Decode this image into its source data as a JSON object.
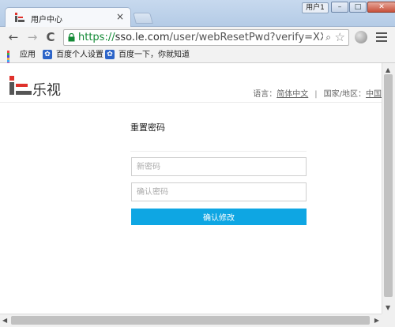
{
  "browser": {
    "tab_title": "用户中心",
    "tab_close": "×",
    "user_label": "用户1",
    "window_buttons": {
      "minimize": "–",
      "maximize": "□",
      "close": "✕"
    },
    "nav": {
      "back": "←",
      "forward": "→",
      "reload": "C"
    },
    "url_scheme": "https://",
    "url_host": "sso.le.com",
    "url_path": "/user/webResetPwd?verify=XXXhaO",
    "zoom_glyph": "⌕",
    "star_glyph": "☆",
    "bookmarks": [
      "应用",
      "百度个人设置",
      "百度一下，你就知道"
    ]
  },
  "page": {
    "brand": "乐视",
    "lang_label": "语言：",
    "lang_value": "简体中文",
    "separator": "|",
    "region_label": "国家/地区：",
    "region_value": "中国",
    "reset_title": "重置密码",
    "new_password_placeholder": "新密码",
    "confirm_password_placeholder": "确认密码",
    "confirm_button": "确认修改"
  },
  "colors": {
    "accent": "#0ea6e3",
    "url_green": "#138a36",
    "logo_red": "#e0312b"
  }
}
